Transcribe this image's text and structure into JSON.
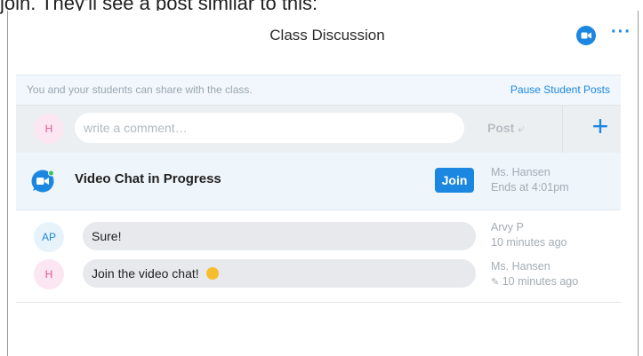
{
  "caption": "join. They'll see a post similar to this:",
  "header": {
    "title": "Class Discussion",
    "chat_icon": "video-chat-icon",
    "more_icon": "more-icon",
    "more_label": "···"
  },
  "share_bar": {
    "text": "You and your students can share with the class.",
    "pause_link": "Pause Student Posts"
  },
  "composer": {
    "avatar": "H",
    "placeholder": "write a comment…",
    "post_label": "Post",
    "add_label": "+"
  },
  "video_chat": {
    "title": "Video Chat in Progress",
    "join_label": "Join",
    "host": "Ms. Hansen",
    "ends": "Ends at 4:01pm"
  },
  "messages": [
    {
      "avatar": "AP",
      "text": "Sure!",
      "author": "Arvy P",
      "time": "10 minutes ago"
    },
    {
      "avatar": "H",
      "text": "Join the video chat!",
      "author": "Ms. Hansen",
      "time": "10 minutes ago"
    }
  ],
  "colors": {
    "accent": "#1c87e0",
    "share_bg": "#f1f7fc",
    "avatar_h_text": "#e6569b",
    "avatar_h_bg": "#fbe6f1"
  }
}
